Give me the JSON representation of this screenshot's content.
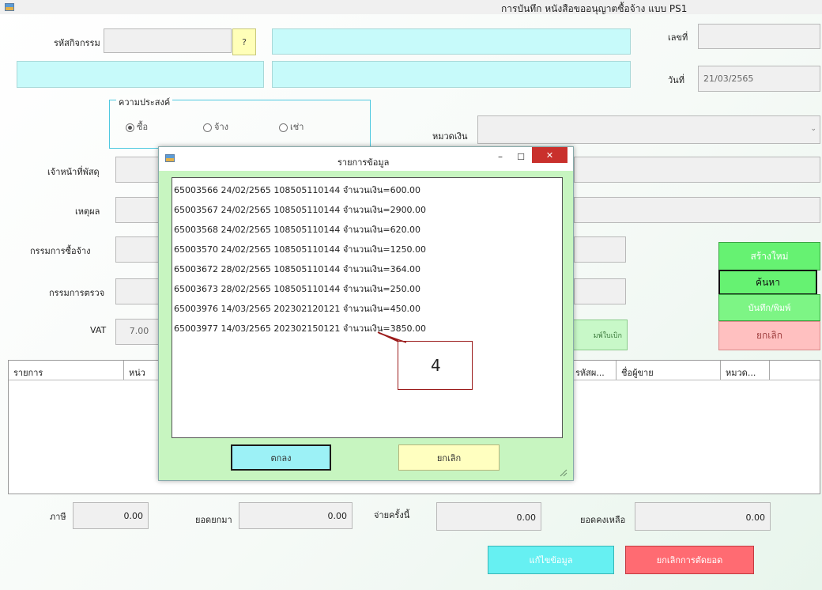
{
  "window": {
    "title": "การบันทึก หนังสือขออนุญาตซื้อจ้าง แบบ PS1"
  },
  "form": {
    "activity_code_label": "รหัสกิจกรรม",
    "lookup_button": "?",
    "number_label": "เลขที่",
    "date_label": "วันที่",
    "date_value": "21/03/2565",
    "purpose_group": "ความประสงค์",
    "purpose_options": [
      "ซื้อ",
      "จ้าง",
      "เช่า"
    ],
    "budget_category_label": "หมวดเงิน",
    "officer_label": "เจ้าหน้าที่พัสดุ",
    "reason_label": "เหตุผล",
    "purchase_committee_label": "กรรมการซื้อจ้าง",
    "inspection_committee_label": "กรรมการตรวจ",
    "vat_label": "VAT",
    "vat_value": "7.00",
    "partial_button": "มพ์ใบเบิก"
  },
  "actions": {
    "new": "สร้างใหม่",
    "search": "ค้นหา",
    "save_print": "บันทึก/พิมพ์",
    "cancel": "ยกเลิก",
    "edit": "แก้ไขข้อมูล",
    "cancel_cut": "ยกเลิกการตัดยอด"
  },
  "grid": {
    "columns": [
      "รายการ",
      "หน่ว",
      "รหัสผ...",
      "ชื่อผู้ขาย",
      "หมวด..."
    ]
  },
  "totals": {
    "tax_label": "ภาษี",
    "tax_value": "0.00",
    "carried_label": "ยอดยกมา",
    "carried_value": "0.00",
    "paid_label": "จ่ายครั้งนี้",
    "paid_value": "0.00",
    "remaining_label": "ยอดคงเหลือ",
    "remaining_value": "0.00"
  },
  "dialog": {
    "title": "รายการข้อมูล",
    "items": [
      "65003566 24/02/2565 108505110144 จำนวนเงิน=600.00",
      "65003567 24/02/2565 108505110144 จำนวนเงิน=2900.00",
      "65003568 24/02/2565 108505110144 จำนวนเงิน=620.00",
      "65003570 24/02/2565 108505110144 จำนวนเงิน=1250.00",
      "65003672 28/02/2565 108505110144 จำนวนเงิน=364.00",
      "65003673 28/02/2565 108505110144 จำนวนเงิน=250.00",
      "65003976 14/03/2565 202302120121 จำนวนเงิน=450.00",
      "65003977 14/03/2565 202302150121 จำนวนเงิน=3850.00"
    ],
    "ok": "ตกลง",
    "cancel": "ยกเลิก"
  },
  "callout": {
    "text": "4"
  },
  "colors": {
    "cyan_field": "#c7fafa",
    "green_button": "#66f272",
    "pink_button": "#ffc0c0",
    "dialog_bg": "#c7f5c0",
    "callout_border": "#9b1b1b"
  },
  "icons": [
    "app-icon",
    "minimize-icon",
    "maximize-icon",
    "close-icon",
    "dropdown-icon",
    "resize-grip-icon"
  ]
}
